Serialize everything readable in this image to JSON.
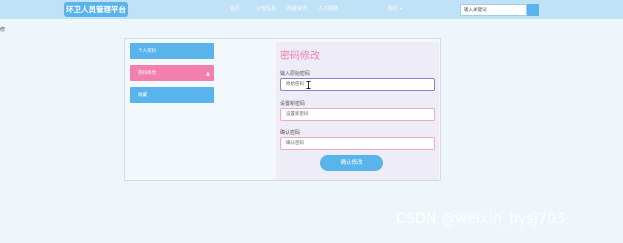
{
  "header": {
    "logo": "环卫人员管理平台",
    "nav": [
      "首页",
      "公告信息",
      "所报资讯",
      "人才招聘"
    ],
    "mine": "我的",
    "search_placeholder": "输入关键词"
  },
  "edge_mark": "修",
  "sidebar": {
    "items": [
      {
        "label": "个人资料",
        "color": "#5ab4ec",
        "active": false
      },
      {
        "label": "密码修改",
        "color": "#f27fae",
        "active": true
      },
      {
        "label": "收藏",
        "color": "#5ab4ec",
        "active": false
      }
    ]
  },
  "panel": {
    "title": "密码修改",
    "fields": [
      {
        "label": "输入原始密码",
        "placeholder": "原始密码"
      },
      {
        "label": "设置新密码",
        "placeholder": "设置新密码"
      },
      {
        "label": "确认密码",
        "placeholder": "确认密码"
      }
    ],
    "confirm_label": "确认修改"
  },
  "watermark": "CSDN @weixin_bysj703",
  "colors": {
    "accent_blue": "#5ab4ec",
    "accent_pink": "#f27fae",
    "header_bg": "#bfe2f7"
  }
}
